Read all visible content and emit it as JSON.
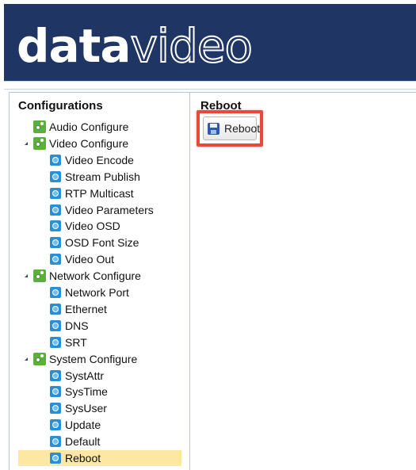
{
  "brand": {
    "part1": "data",
    "part2": "video"
  },
  "sidebar": {
    "title": "Configurations",
    "items": [
      {
        "label": "Audio Configure",
        "level": 0,
        "icon": "gear-folder-icon"
      },
      {
        "label": "Video Configure",
        "level": 0,
        "icon": "gear-folder-icon",
        "expanded": true
      },
      {
        "label": "Video Encode",
        "level": 1,
        "icon": "gear-icon"
      },
      {
        "label": "Stream Publish",
        "level": 1,
        "icon": "gear-icon"
      },
      {
        "label": "RTP Multicast",
        "level": 1,
        "icon": "gear-icon"
      },
      {
        "label": "Video Parameters",
        "level": 1,
        "icon": "gear-icon"
      },
      {
        "label": "Video OSD",
        "level": 1,
        "icon": "gear-icon"
      },
      {
        "label": "OSD Font Size",
        "level": 1,
        "icon": "gear-icon"
      },
      {
        "label": "Video Out",
        "level": 1,
        "icon": "gear-icon"
      },
      {
        "label": "Network Configure",
        "level": 0,
        "icon": "gear-folder-icon",
        "expanded": true
      },
      {
        "label": "Network Port",
        "level": 1,
        "icon": "gear-icon"
      },
      {
        "label": "Ethernet",
        "level": 1,
        "icon": "gear-icon"
      },
      {
        "label": "DNS",
        "level": 1,
        "icon": "gear-icon"
      },
      {
        "label": "SRT",
        "level": 1,
        "icon": "gear-icon"
      },
      {
        "label": "System Configure",
        "level": 0,
        "icon": "gear-folder-icon",
        "expanded": true
      },
      {
        "label": "SystAttr",
        "level": 1,
        "icon": "gear-icon"
      },
      {
        "label": "SysTime",
        "level": 1,
        "icon": "gear-icon"
      },
      {
        "label": "SysUser",
        "level": 1,
        "icon": "gear-icon"
      },
      {
        "label": "Update",
        "level": 1,
        "icon": "gear-icon"
      },
      {
        "label": "Default",
        "level": 1,
        "icon": "gear-icon"
      },
      {
        "label": "Reboot",
        "level": 1,
        "icon": "gear-icon",
        "selected": true
      }
    ]
  },
  "main": {
    "title": "Reboot",
    "reboot_label": "Reboot"
  },
  "colors": {
    "header": "#1f3563",
    "selection": "#fce7a3",
    "highlight": "#e8493f"
  }
}
